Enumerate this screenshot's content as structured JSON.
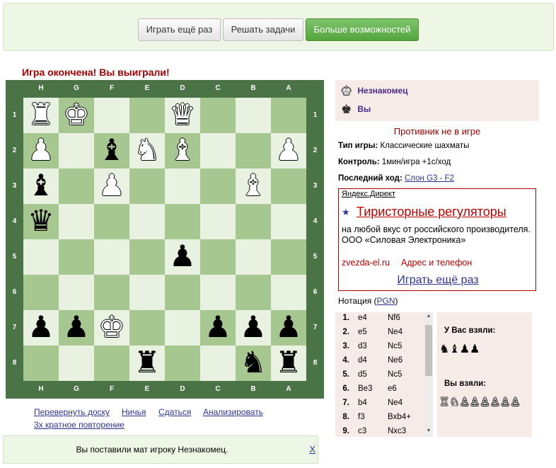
{
  "toolbar": {
    "play_again": "Играть ещё раз",
    "solve_puzzles": "Решать задачи",
    "more_options": "Больше возможностей"
  },
  "game_status": "Игра окончена! Вы выиграли!",
  "board": {
    "files": [
      "H",
      "G",
      "F",
      "E",
      "D",
      "C",
      "B",
      "A"
    ],
    "ranks": [
      "1",
      "2",
      "3",
      "4",
      "5",
      "6",
      "7",
      "8"
    ],
    "rows": [
      [
        {
          "g": "♜",
          "c": "w"
        },
        {
          "g": "♚",
          "c": "w"
        },
        null,
        null,
        {
          "g": "♛",
          "c": "w"
        },
        null,
        null,
        null
      ],
      [
        {
          "g": "♟",
          "c": "w"
        },
        null,
        {
          "g": "♝",
          "c": "b"
        },
        {
          "g": "♞",
          "c": "w"
        },
        {
          "g": "♝",
          "c": "w"
        },
        null,
        null,
        {
          "g": "♟",
          "c": "w"
        }
      ],
      [
        {
          "g": "♝",
          "c": "b"
        },
        null,
        {
          "g": "♟",
          "c": "w"
        },
        null,
        null,
        null,
        {
          "g": "♝",
          "c": "w"
        },
        null
      ],
      [
        {
          "g": "♛",
          "c": "b"
        },
        null,
        null,
        null,
        null,
        null,
        null,
        null
      ],
      [
        null,
        null,
        null,
        null,
        {
          "g": "♟",
          "c": "b"
        },
        null,
        null,
        null
      ],
      [
        null,
        null,
        null,
        null,
        null,
        null,
        null,
        null
      ],
      [
        {
          "g": "♟",
          "c": "b"
        },
        {
          "g": "♟",
          "c": "b"
        },
        {
          "g": "♚",
          "c": "w"
        },
        null,
        null,
        {
          "g": "♟",
          "c": "b"
        },
        {
          "g": "♟",
          "c": "b"
        },
        {
          "g": "♟",
          "c": "b"
        }
      ],
      [
        null,
        null,
        null,
        {
          "g": "♜",
          "c": "b"
        },
        null,
        null,
        {
          "g": "♞",
          "c": "b"
        },
        {
          "g": "♜",
          "c": "b"
        }
      ]
    ],
    "light_color": "#e9f2e1",
    "dark_color": "#a7c790",
    "frame_color": "#4a7446"
  },
  "links": {
    "flip_board": "Перевернуть доску",
    "draw": "Ничья",
    "resign": "Сдаться",
    "analyze": "Анализировать",
    "threefold": "3х кратное повторение"
  },
  "players": {
    "opponent": {
      "icon": "white-king-icon",
      "name": "Незнакомец"
    },
    "me": {
      "icon": "black-king-icon",
      "name": "Вы"
    }
  },
  "opponent_status": "Противник не в игре",
  "game_info": {
    "type_label": "Тип игры:",
    "type_value": "Классические шахматы",
    "control_label": "Контроль:",
    "control_value": "1мин/игра +1с/ход",
    "last_move_label": "Последний ход:",
    "last_move_value": "Слон G3 - F2"
  },
  "ad": {
    "source": "Яндекс.Директ",
    "title": "Тиристорные регуляторы",
    "text": "на любой вкус от российского производителя. ООО «Силовая Электроника»",
    "site": "zvezda-el.ru",
    "contacts": "Адрес и телефон",
    "play_again": "Играть ещё раз"
  },
  "notation": {
    "label": "Нотация (",
    "link": "PGN",
    "close": ")"
  },
  "moves": [
    {
      "n": "1.",
      "w": "e4",
      "b": "Nf6"
    },
    {
      "n": "2.",
      "w": "e5",
      "b": "Ne4"
    },
    {
      "n": "3.",
      "w": "d3",
      "b": "Nc5"
    },
    {
      "n": "4.",
      "w": "d4",
      "b": "Ne6"
    },
    {
      "n": "5.",
      "w": "d5",
      "b": "Nc5"
    },
    {
      "n": "6.",
      "w": "Be3",
      "b": "e6"
    },
    {
      "n": "7.",
      "w": "b4",
      "b": "Ne4"
    },
    {
      "n": "8.",
      "w": "f3",
      "b": "Bxb4+"
    },
    {
      "n": "9.",
      "w": "c3",
      "b": "Nxc3"
    }
  ],
  "captures": {
    "taken_from_you_label": "У Вас взяли:",
    "taken_from_you": "♞♝♟♟",
    "you_took_label": "Вы взяли:",
    "you_took": "♖♘♙♙♙♙♙♙"
  },
  "message": {
    "text": "Вы поставили мат игроку Незнакомец.",
    "close": "X"
  }
}
